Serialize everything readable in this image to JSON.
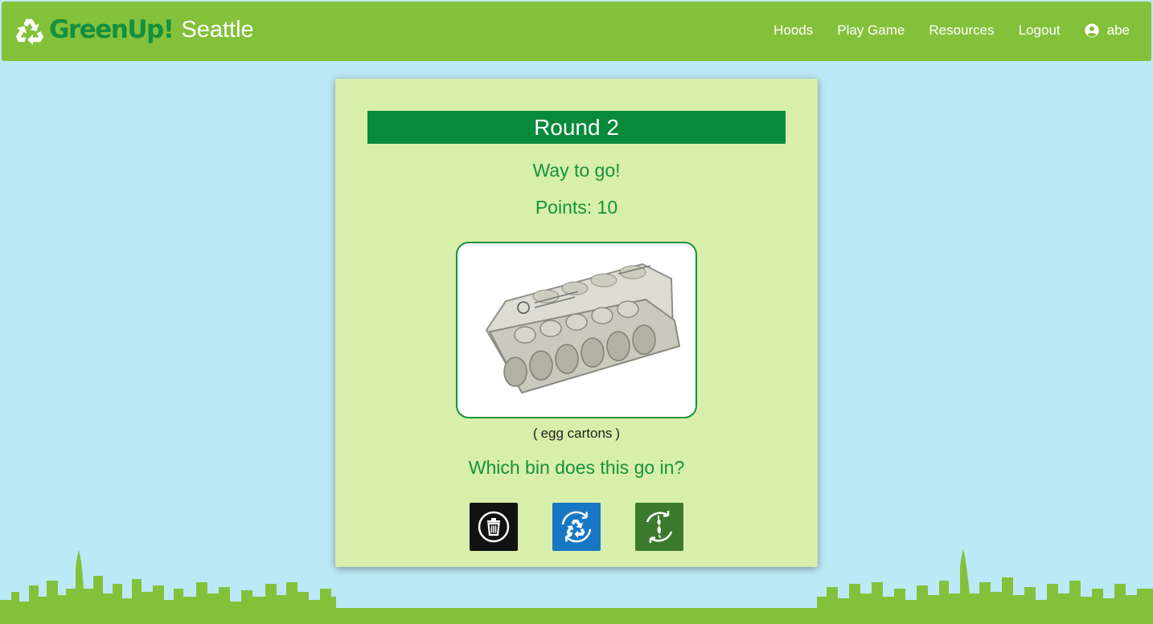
{
  "brand": {
    "name": "GreenUp!",
    "city": "Seattle",
    "logo_icon": "recycle-icon"
  },
  "nav": {
    "links": [
      {
        "label": "Hoods"
      },
      {
        "label": "Play Game"
      },
      {
        "label": "Resources"
      },
      {
        "label": "Logout"
      }
    ],
    "user": {
      "name": "abe",
      "icon": "user-circle-icon"
    }
  },
  "game": {
    "round_label": "Round 2",
    "feedback": "Way to go!",
    "points_label": "Points: 10",
    "item": {
      "name": "egg cartons",
      "image_alt": "egg cartons"
    },
    "question": "Which bin does this go in?",
    "bins": [
      {
        "name": "trash",
        "icon": "trash-icon",
        "color": "#121212"
      },
      {
        "name": "recycling",
        "icon": "recycle-icon",
        "color": "#1777c3"
      },
      {
        "name": "compost",
        "icon": "compost-icon",
        "color": "#3b7a2d"
      }
    ]
  },
  "colors": {
    "navbar": "#84c13b",
    "background": "#bde9f7",
    "card": "#d7efaa",
    "accent": "#078a3b",
    "text_green": "#14923e"
  }
}
